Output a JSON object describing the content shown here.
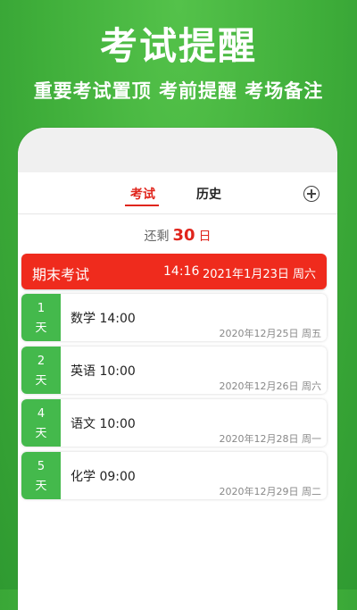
{
  "promo": {
    "title": "考试提醒",
    "subtitle": "重要考试置顶 考前提醒 考场备注"
  },
  "tabs": [
    {
      "label": "考试",
      "active": true
    },
    {
      "label": "历史",
      "active": false
    }
  ],
  "remaining": {
    "prefix": "还剩",
    "days": "30",
    "unit": "日"
  },
  "featured_exam": {
    "name": "期末考试",
    "time": "14:16",
    "date": "2021年1月23日 周六"
  },
  "exams": [
    {
      "days": "1",
      "unit": "天",
      "subject": "数学  14:00",
      "date": "2020年12月25日 周五"
    },
    {
      "days": "2",
      "unit": "天",
      "subject": "英语  10:00",
      "date": "2020年12月26日 周六"
    },
    {
      "days": "4",
      "unit": "天",
      "subject": "语文  10:00",
      "date": "2020年12月28日 周一"
    },
    {
      "days": "5",
      "unit": "天",
      "subject": "化学  09:00",
      "date": "2020年12月29日 周二"
    }
  ],
  "colors": {
    "accent_red": "#e0251c",
    "day_green": "#44b94c",
    "background_green": "#3fae3a"
  },
  "icons": {
    "add": "plus-circle-icon"
  }
}
